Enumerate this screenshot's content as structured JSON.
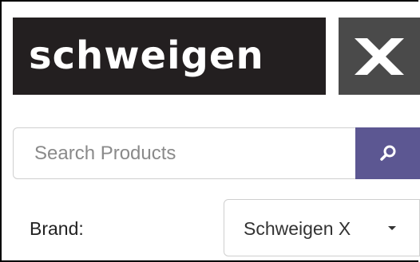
{
  "logo": {
    "wordmark": "schweigen",
    "x_mark": "X",
    "colors": {
      "wordmark_bg": "#231f20",
      "x_bg": "#4a4a4a",
      "text": "#ffffff"
    }
  },
  "search": {
    "placeholder": "Search Products",
    "value": "",
    "button_icon": "search-icon",
    "button_color": "#5c5792"
  },
  "brand": {
    "label": "Brand:",
    "selected": "Schweigen X",
    "dropdown_icon": "caret-down-icon"
  }
}
